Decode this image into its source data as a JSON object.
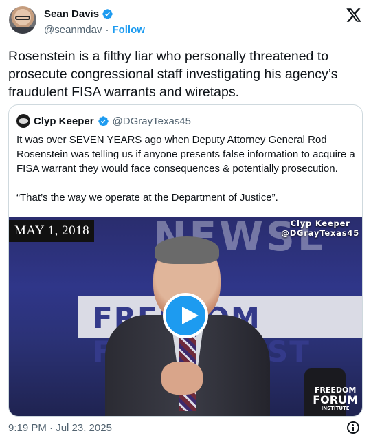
{
  "post": {
    "author_name": "Sean Davis",
    "author_handle": "@seanmdav",
    "separator": "·",
    "follow_label": "Follow",
    "text": "Rosenstein is a filthy liar who personally threatened to prosecute congressional staff investigating his agency’s fraudulent FISA warrants and wiretaps.",
    "timestamp": "9:19 PM · Jul 23, 2025"
  },
  "quote": {
    "author_name": "Clyp Keeper",
    "author_handle": "@DGrayTexas45",
    "paragraph_1": "It was over SEVEN YEARS ago when Deputy Attorney General Rod Rosenstein was telling us if anyone presents false information to acquire a FISA warrant they would face consequences & potentially prosecution.",
    "paragraph_2": "“That’s the way we operate at the Department of Justice”.",
    "video": {
      "date_overlay": "MAY 1, 2018",
      "watermark_line1": "Clyp Keeper",
      "watermark_line2": "@DGrayTexas45",
      "background_text": "NEWSL",
      "band_text": "FREEDOM FORUM INST",
      "logo_line1": "FREEDOM",
      "logo_line2": "FORUM",
      "logo_line3": "INSTITUTE"
    }
  },
  "colors": {
    "accent": "#1d9bf0",
    "text_primary": "#0f1419",
    "text_secondary": "#536471",
    "border": "#cfd9de"
  },
  "icons": [
    "verified-badge-icon",
    "x-logo-icon",
    "play-icon",
    "info-icon"
  ]
}
